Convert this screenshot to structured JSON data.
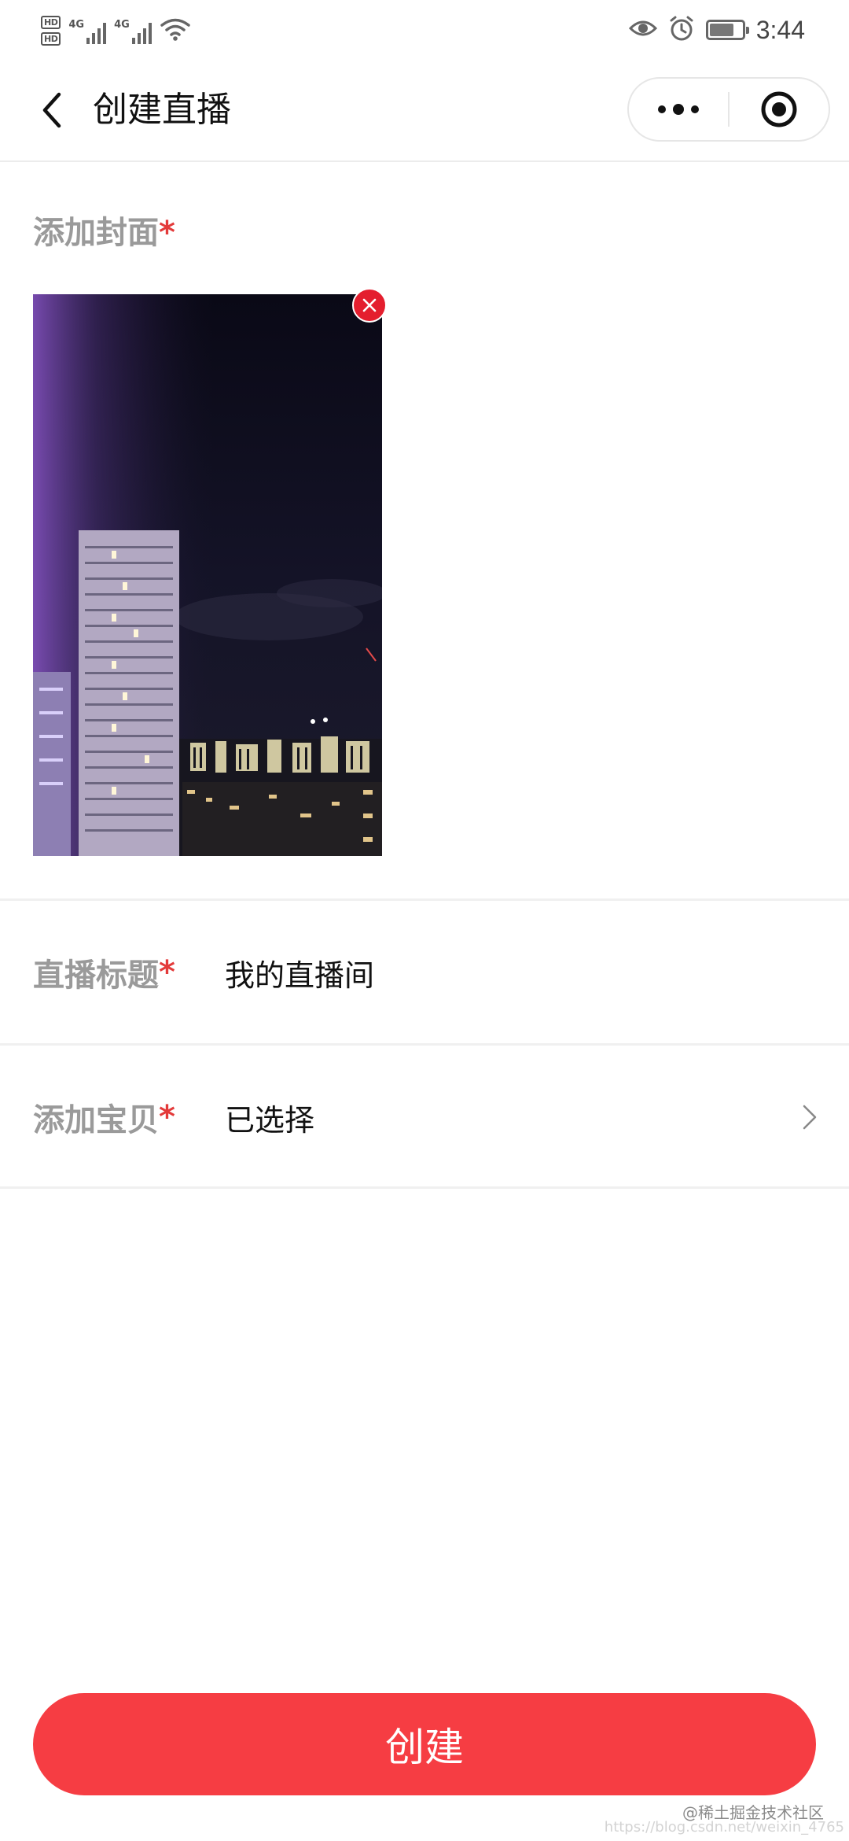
{
  "status_bar": {
    "sim1_label": "HD",
    "sim2_label": "HD",
    "net1": "4G",
    "net2": "4G",
    "time": "3:44",
    "battery_level": 0.75
  },
  "navbar": {
    "title": "创建直播"
  },
  "cover": {
    "label": "添加封面",
    "required_mark": "*"
  },
  "form": {
    "title_label": "直播标题",
    "title_required": "*",
    "title_value": "我的直播间",
    "goods_label": "添加宝贝",
    "goods_required": "*",
    "goods_value": "已选择"
  },
  "actions": {
    "create_label": "创建"
  },
  "watermark": {
    "text": "@稀土掘金技术社区",
    "url": "https://blog.csdn.net/weixin_4765"
  },
  "colors": {
    "accent": "#f63d43",
    "remove_button": "#e41e2e",
    "required": "#e33a3a",
    "label": "#9a9a9a"
  },
  "icons": [
    "back-arrow-icon",
    "more-dots-icon",
    "close-target-icon",
    "remove-x-icon",
    "chevron-right-icon",
    "eye-icon",
    "alarm-icon",
    "wifi-icon",
    "battery-icon"
  ]
}
